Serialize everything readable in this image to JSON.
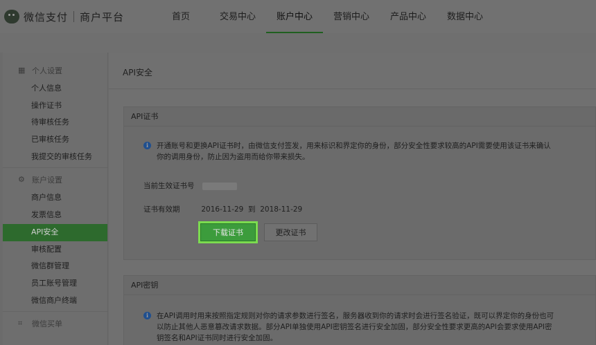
{
  "header": {
    "brand": "微信支付",
    "sub_brand": "商户平台",
    "nav": [
      {
        "label": "首页"
      },
      {
        "label": "交易中心"
      },
      {
        "label": "账户中心"
      },
      {
        "label": "营销中心"
      },
      {
        "label": "产品中心"
      },
      {
        "label": "数据中心"
      }
    ],
    "active_nav": "账户中心"
  },
  "sidebar": {
    "groups": [
      {
        "title": "个人设置",
        "icon": "grid-icon",
        "items": [
          "个人信息",
          "操作证书",
          "待审核任务",
          "已审核任务",
          "我提交的审核任务"
        ]
      },
      {
        "title": "账户设置",
        "icon": "gear-icon",
        "items": [
          "商户信息",
          "发票信息",
          "API安全",
          "审核配置",
          "微信群管理",
          "员工账号管理",
          "微信商户终端"
        ]
      },
      {
        "title": "微信买单",
        "icon": "scan-icon",
        "items": []
      }
    ],
    "active_item": "API安全"
  },
  "main": {
    "title": "API安全",
    "cert_card": {
      "title": "API证书",
      "notice": "开通账号和更换API证书时，由微信支付签发，用来标识和界定你的身份，部分安全性要求较高的API需要使用该证书来确认你的调用身份，防止因为盗用而给你带来损失。",
      "current_cert_label": "当前生效证书号",
      "validity_label": "证书有效期",
      "validity_value": "2016-11-29  到  2018-11-29",
      "download_button": "下载证书",
      "change_button": "更改证书"
    },
    "key_card": {
      "title": "API密钥",
      "notice": "在API调用时用来按照指定规则对你的请求参数进行签名，服务器收到你的请求时会进行签名验证，既可以界定你的身份也可以防止其他人恶意篡改请求数据。部分API单独使用API密钥签名进行安全加固，部分安全性要求更高的API会要求使用API密钥签名和API证书同时进行安全加固。"
    }
  },
  "colors": {
    "accent_green": "#3c9c3c",
    "highlight_border": "#7bdc4f",
    "info_blue": "#1f4f8f"
  }
}
